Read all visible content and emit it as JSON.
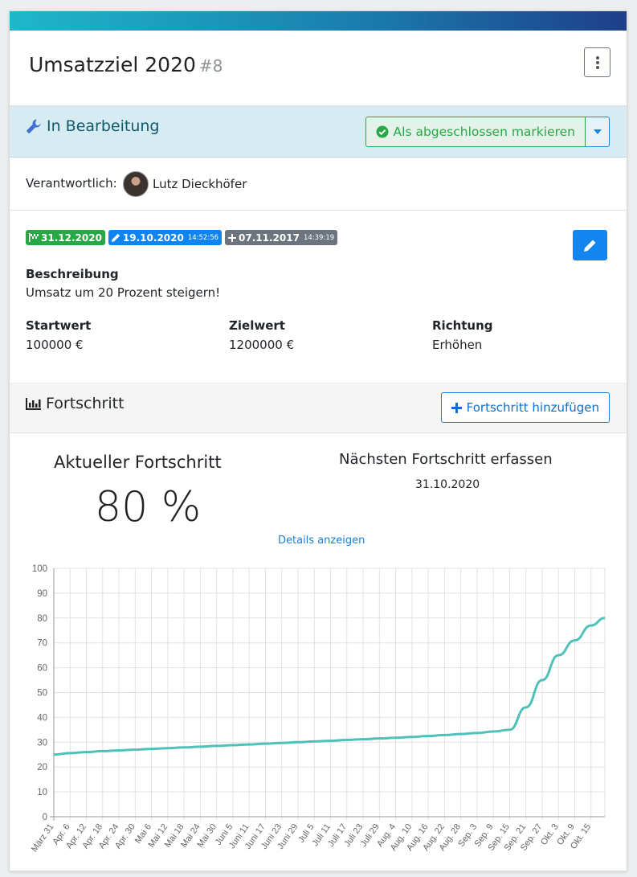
{
  "header": {
    "title": "Umsatzziel 2020",
    "number": "#8"
  },
  "status": {
    "label": "In Bearbeitung",
    "complete_button": "Als abgeschlossen markieren"
  },
  "responsible": {
    "label": "Verantwortlich:",
    "name": "Lutz Dieckhöfer"
  },
  "badges": {
    "due": "31.12.2020",
    "edited_date": "19.10.2020",
    "edited_time": "14:52:56",
    "created_date": "07.11.2017",
    "created_time": "14:39:19"
  },
  "description": {
    "heading": "Beschreibung",
    "text": "Umsatz um 20 Prozent steigern!"
  },
  "fields": [
    {
      "label": "Startwert",
      "value": "100000 €"
    },
    {
      "label": "Zielwert",
      "value": "1200000 €"
    },
    {
      "label": "Richtung",
      "value": "Erhöhen"
    }
  ],
  "progress": {
    "heading": "Fortschritt",
    "add_button": "Fortschritt hinzufügen",
    "current_heading": "Aktueller Fortschritt",
    "current_value": "80 %",
    "next_heading": "Nächsten Fortschritt erfassen",
    "next_date": "31.10.2020",
    "details_link": "Details anzeigen"
  },
  "colors": {
    "line": "#4fc1bb",
    "grid": "#e2e2e2",
    "success": "#28a745",
    "primary": "#0d84f0"
  },
  "chart_data": {
    "type": "line",
    "categories": [
      "März 31",
      "Apr. 6",
      "Apr. 12",
      "Apr. 18",
      "Apr. 24",
      "Apr. 30",
      "Mai 6",
      "Mai 12",
      "Mai 18",
      "Mai 24",
      "Mai 30",
      "Juni 5",
      "Juni 11",
      "Juni 17",
      "Juni 23",
      "Juni 29",
      "Juli 5",
      "Juli 11",
      "Juli 17",
      "Juli 23",
      "Juli 29",
      "Aug. 4",
      "Aug. 10",
      "Aug. 16",
      "Aug. 22",
      "Aug. 28",
      "Sep. 3",
      "Sep. 9",
      "Sep. 15",
      "Sep. 21",
      "Sep. 27",
      "Okt. 3",
      "Okt. 9",
      "Okt. 15"
    ],
    "series": [
      {
        "values": [
          25,
          25.6,
          26.0,
          26.4,
          26.7,
          27.0,
          27.3,
          27.6,
          27.9,
          28.2,
          28.5,
          28.8,
          29.1,
          29.4,
          29.7,
          30.0,
          30.3,
          30.6,
          30.9,
          31.2,
          31.5,
          31.8,
          32.1,
          32.5,
          32.9,
          33.3,
          33.7,
          34.3,
          35.0,
          44.0,
          55.0,
          65.0,
          71.0,
          77.0
        ],
        "end_value": 80
      }
    ],
    "ylim": [
      0,
      100
    ],
    "yticks": [
      0,
      10,
      20,
      30,
      40,
      50,
      60,
      70,
      80,
      90,
      100
    ],
    "grid": true
  }
}
